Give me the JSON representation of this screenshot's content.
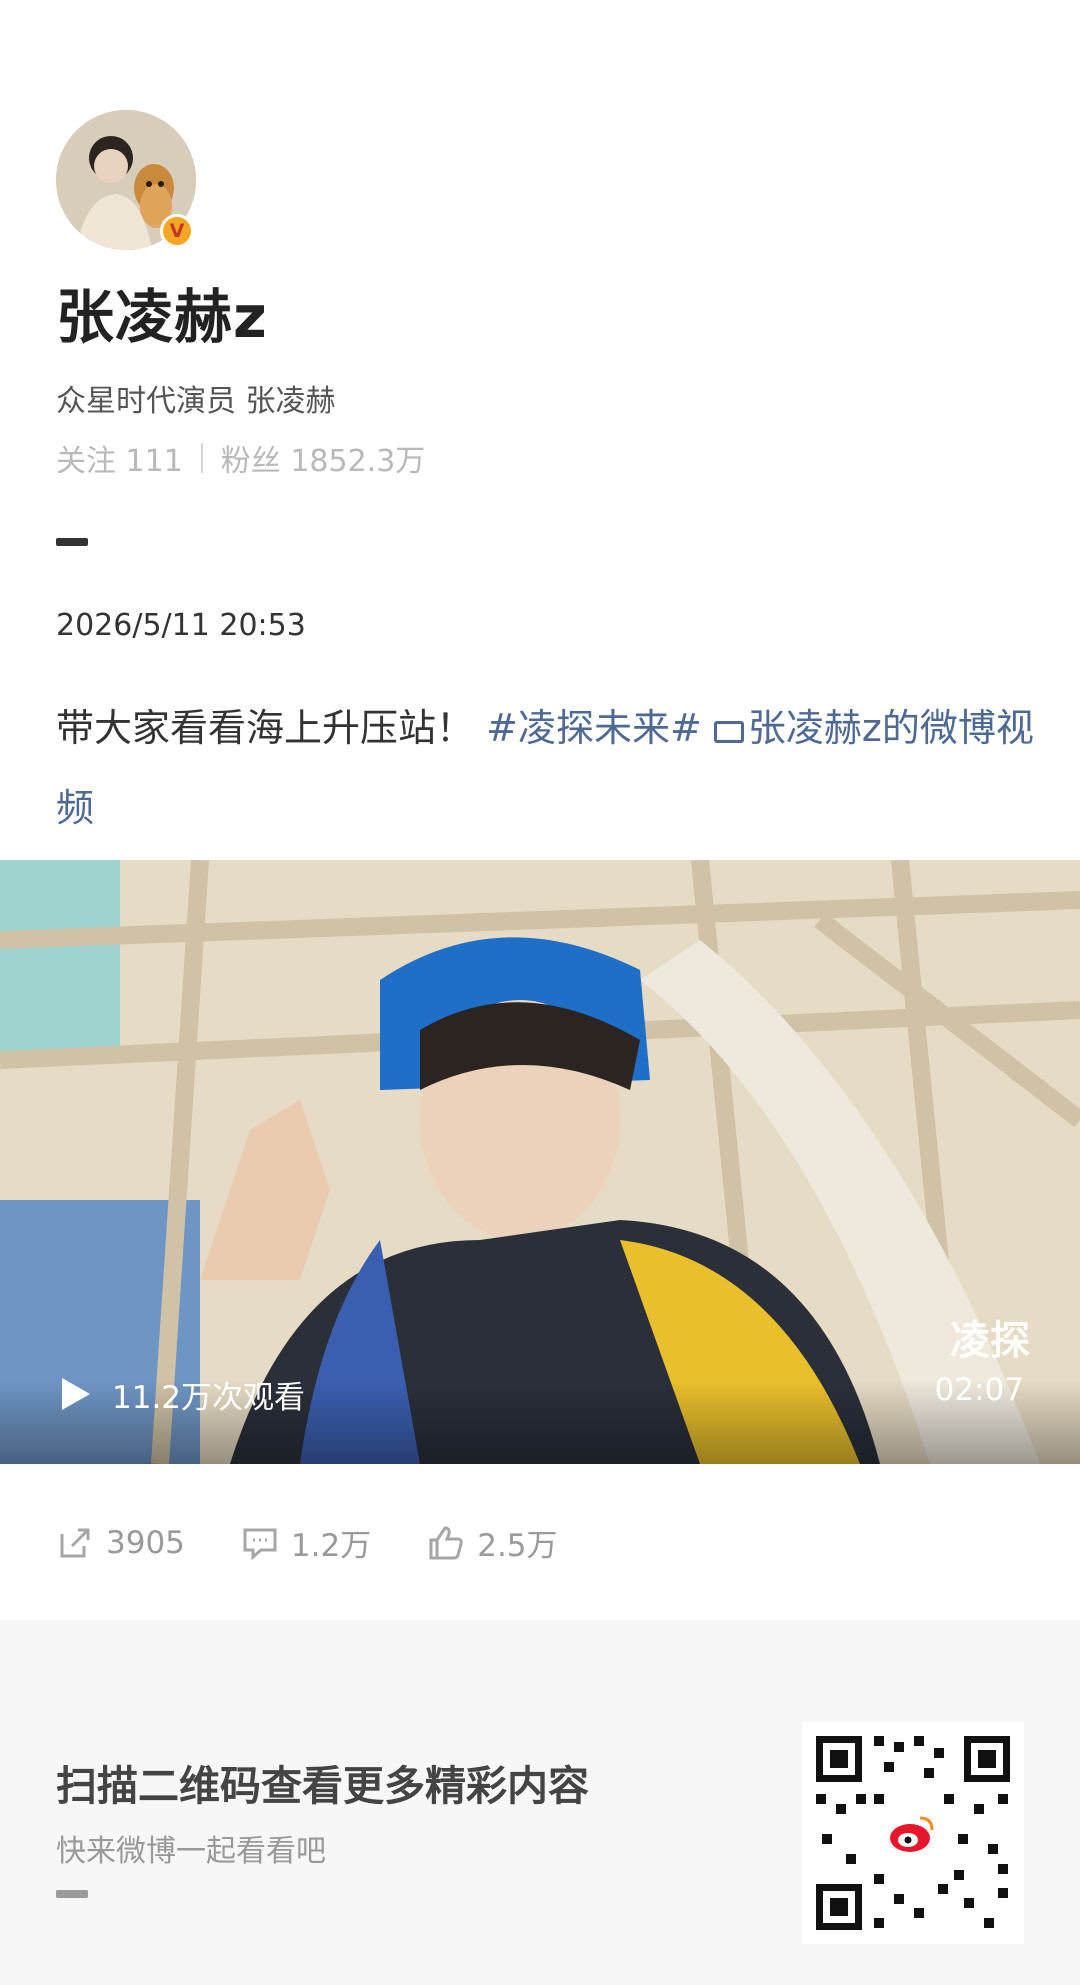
{
  "profile": {
    "username": "张凌赫z",
    "bio": "众星时代演员 张凌赫",
    "following_label": "关注 111",
    "followers_label": "粉丝 1852.3万",
    "verified_mark": "V"
  },
  "post": {
    "timestamp": "2026/5/11 20:53",
    "text": "带大家看看海上升压站！",
    "hashtag": "#凌探未来#",
    "video_link": "张凌赫z的微博视频"
  },
  "video": {
    "views": "11.2万次观看",
    "duration": "02:07",
    "brand": "凌探",
    "progress": 0
  },
  "actions": {
    "repost_count": "3905",
    "comment_count": "1.2万",
    "like_count": "2.5万"
  },
  "footer": {
    "title": "扫描二维码查看更多精彩内容",
    "subtitle": "快来微博一起看看吧"
  },
  "colors": {
    "link": "#4e6a94",
    "verified_badge": "#f5a623"
  },
  "icons": [
    "verified-icon",
    "video-link-icon",
    "play-icon",
    "repost-icon",
    "comment-icon",
    "like-icon",
    "weibo-logo-icon"
  ]
}
